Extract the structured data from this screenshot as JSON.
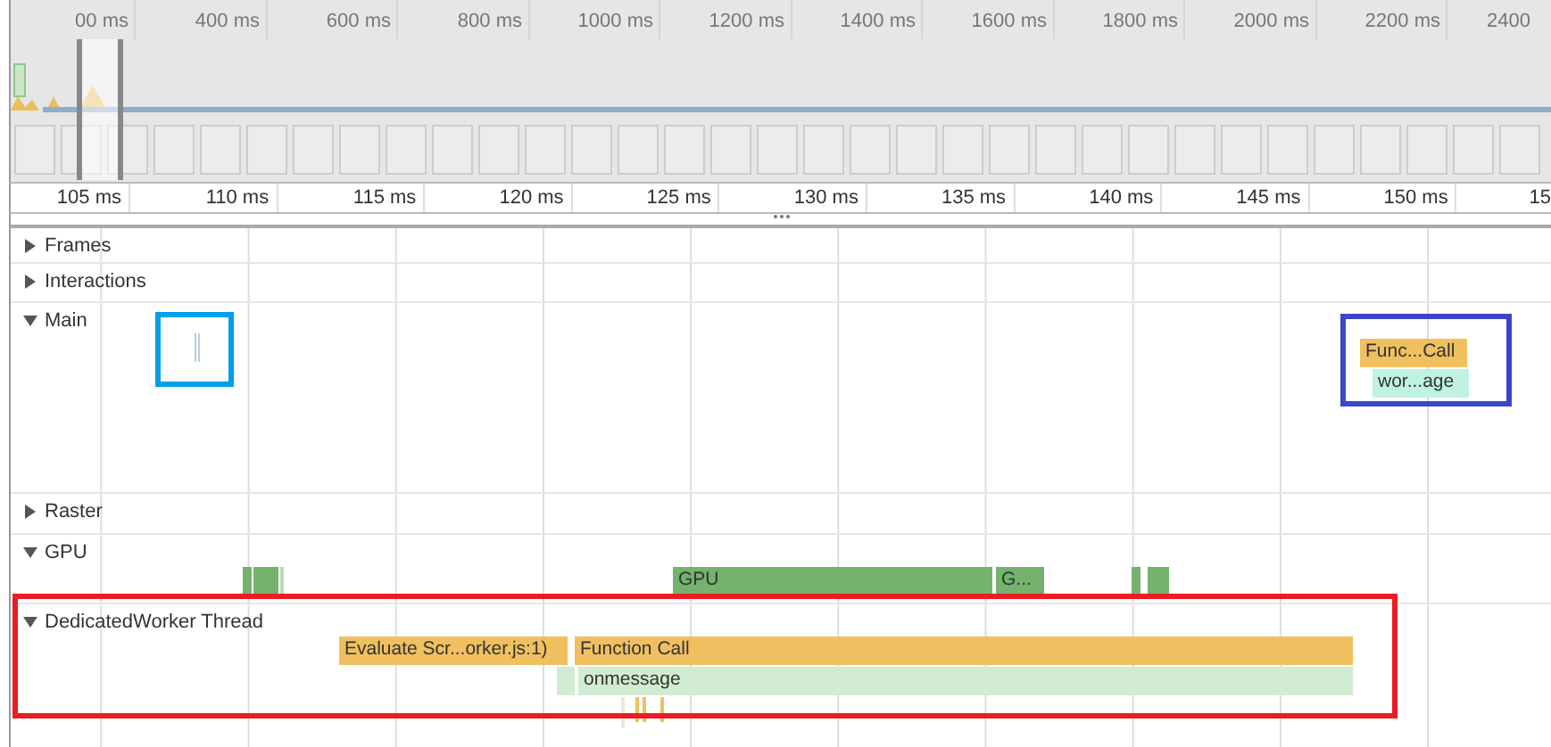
{
  "overview": {
    "tick_labels": [
      "00 ms",
      "400 ms",
      "600 ms",
      "800 ms",
      "1000 ms",
      "1200 ms",
      "1400 ms",
      "1600 ms",
      "1800 ms",
      "2000 ms",
      "2200 ms",
      "2400"
    ]
  },
  "ruler": {
    "labels": [
      "105 ms",
      "110 ms",
      "115 ms",
      "120 ms",
      "125 ms",
      "130 ms",
      "135 ms",
      "140 ms",
      "145 ms",
      "150 ms",
      "15"
    ]
  },
  "tracks": [
    {
      "name": "Frames",
      "expanded": false
    },
    {
      "name": "Interactions",
      "expanded": false
    },
    {
      "name": "Main",
      "expanded": true,
      "events": [
        {
          "label": "Func...Call",
          "kind": "call"
        },
        {
          "label": "wor...age",
          "kind": "message"
        }
      ]
    },
    {
      "name": "Raster",
      "expanded": false
    },
    {
      "name": "GPU",
      "expanded": true,
      "events": [
        {
          "label": "GPU",
          "kind": "gpu"
        },
        {
          "label": "G...",
          "kind": "gpu"
        }
      ]
    },
    {
      "name": "DedicatedWorker Thread",
      "expanded": true,
      "events": [
        {
          "label": "Evaluate Scr...orker.js:1)",
          "kind": "call"
        },
        {
          "label": "Function Call",
          "kind": "call"
        },
        {
          "label": "onmessage",
          "kind": "handler"
        }
      ]
    }
  ],
  "highlight_boxes": [
    {
      "color": "#00a0e8"
    },
    {
      "color": "#3c46c8"
    },
    {
      "color": "#ec1c24"
    }
  ]
}
